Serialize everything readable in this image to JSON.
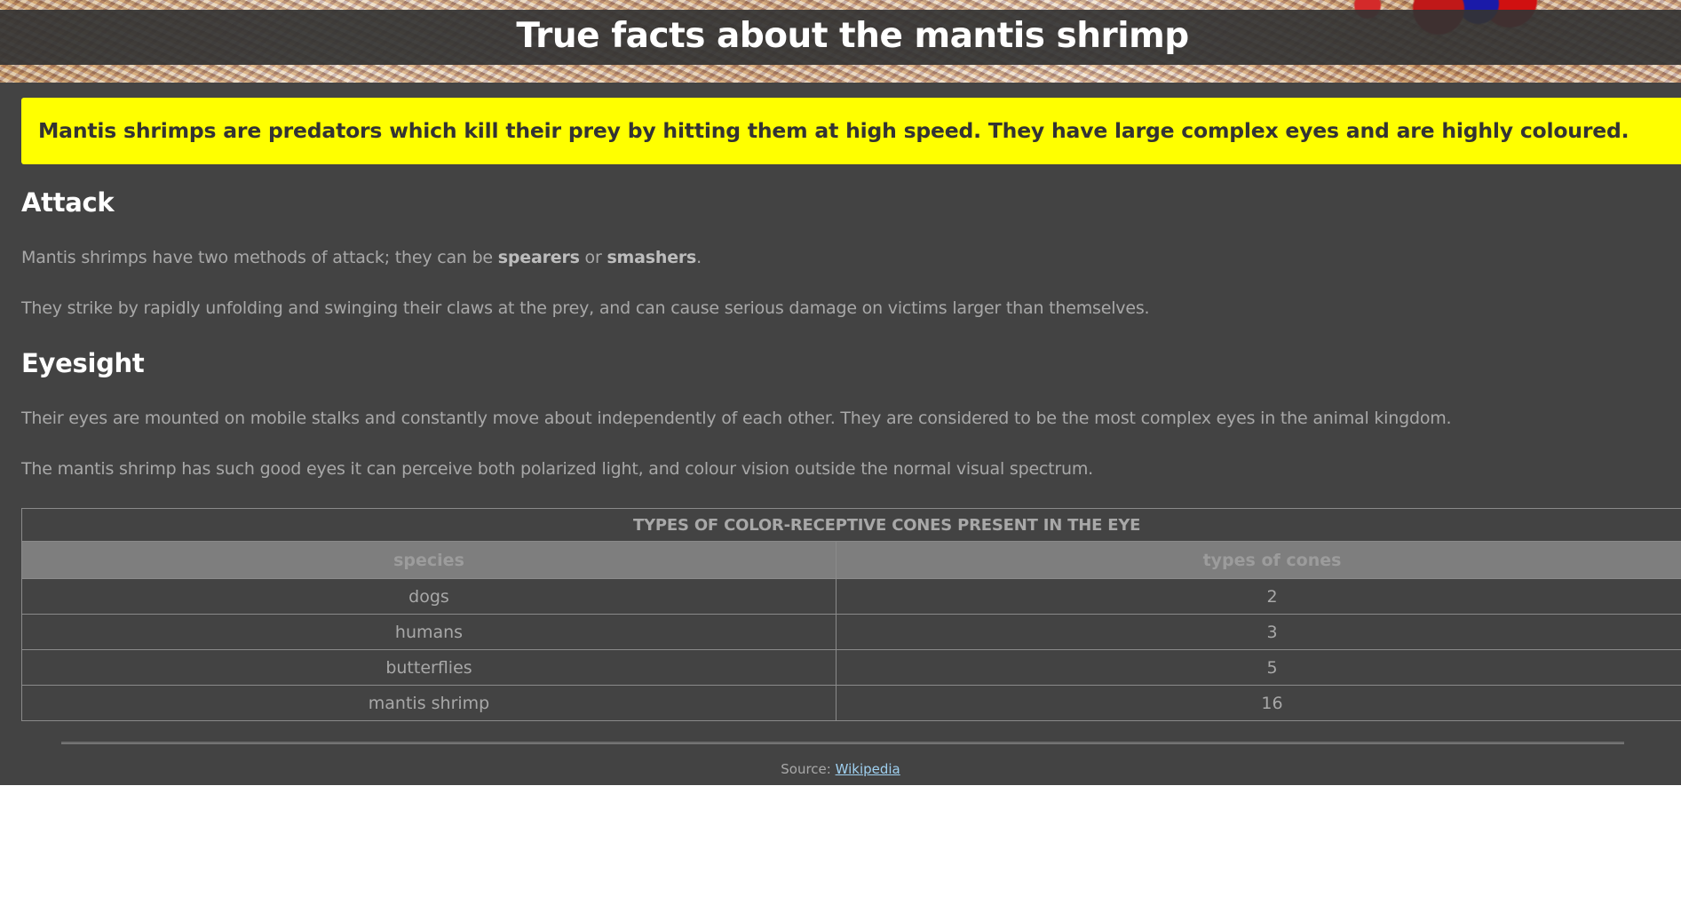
{
  "header": {
    "title": "True facts about the mantis shrimp"
  },
  "intro": "Mantis shrimps are predators which kill their prey by hitting them at high speed. They have large complex eyes and are highly coloured.",
  "sections": {
    "attack": {
      "heading": "Attack",
      "p1_before": "Mantis shrimps have two methods of attack; they can be ",
      "p1_bold1": "spearers",
      "p1_mid": " or ",
      "p1_bold2": "smashers",
      "p1_after": ".",
      "p2": "They strike by rapidly unfolding and swinging their claws at the prey, and can cause serious damage on victims larger than themselves."
    },
    "eyesight": {
      "heading": "Eyesight",
      "p1": "Their eyes are mounted on mobile stalks and constantly move about independently of each other. They are considered to be the most complex eyes in the animal kingdom.",
      "p2": "The mantis shrimp has such good eyes it can perceive both polarized light, and colour vision outside the normal visual spectrum."
    }
  },
  "table": {
    "caption": "TYPES OF COLOR-RECEPTIVE CONES PRESENT IN THE EYE",
    "headers": [
      "species",
      "types of cones"
    ],
    "rows": [
      [
        "dogs",
        "2"
      ],
      [
        "humans",
        "3"
      ],
      [
        "butterflies",
        "5"
      ],
      [
        "mantis shrimp",
        "16"
      ]
    ]
  },
  "footer": {
    "source_label": "Source: ",
    "link_text": "Wikipedia"
  },
  "colors": {
    "page_background": "#434343",
    "intro_background": "#ffff00",
    "link": "#9fd0f0"
  }
}
